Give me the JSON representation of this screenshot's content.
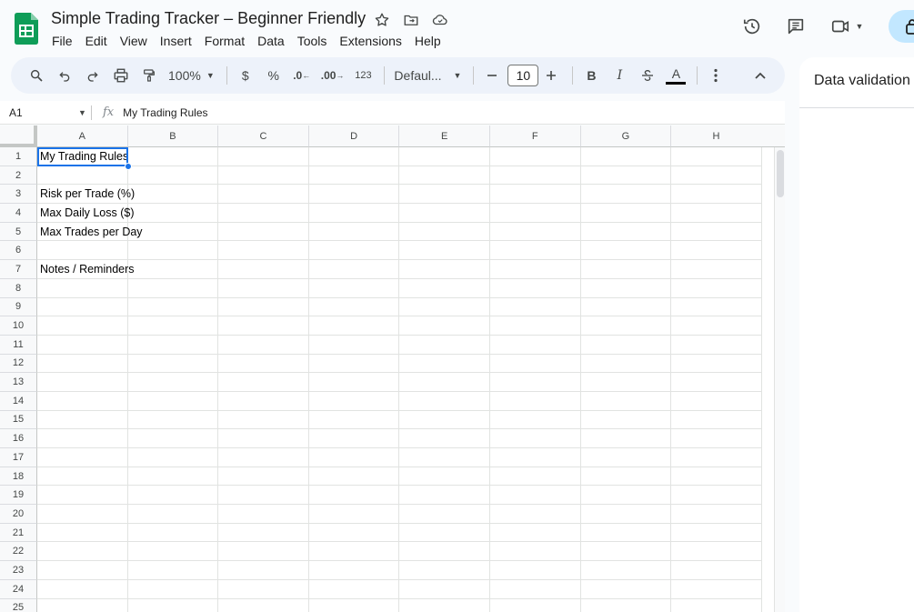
{
  "document": {
    "title": "Simple Trading Tracker – Beginner Friendly"
  },
  "menu": [
    "File",
    "Edit",
    "View",
    "Insert",
    "Format",
    "Data",
    "Tools",
    "Extensions",
    "Help"
  ],
  "toolbar": {
    "zoom": "100%",
    "currency": "$",
    "percent": "%",
    "decrease_decimal": ".0",
    "increase_decimal": ".00",
    "number_format": "123",
    "font": "Defaul...",
    "font_size": "10",
    "bold": "B",
    "italic": "I",
    "text_color_letter": "A"
  },
  "formula_bar": {
    "cell_ref": "A1",
    "fx": "fx",
    "content": "My Trading Rules"
  },
  "side_panel": {
    "title": "Data validation"
  },
  "grid": {
    "columns": [
      "A",
      "B",
      "C",
      "D",
      "E",
      "F",
      "G",
      "H"
    ],
    "rows": [
      "1",
      "2",
      "3",
      "4",
      "5",
      "6",
      "7",
      "8",
      "9",
      "10",
      "11",
      "12",
      "13",
      "14",
      "15",
      "16",
      "17",
      "18",
      "19",
      "20",
      "21",
      "22",
      "23",
      "24",
      "25"
    ],
    "cells_col_a": [
      "My Trading Rules",
      "",
      "Risk per Trade (%)",
      "Max Daily Loss ($)",
      "Max Trades per Day",
      "",
      "Notes / Reminders",
      "",
      "",
      "",
      "",
      "",
      "",
      "",
      "",
      "",
      "",
      "",
      "",
      "",
      "",
      "",
      "",
      "",
      ""
    ]
  },
  "colors": {
    "accent": "#1a73e8",
    "sheets_green": "#0f9d58",
    "toolbar_bg": "#edf2fa",
    "share_bg": "#c2e7ff"
  }
}
